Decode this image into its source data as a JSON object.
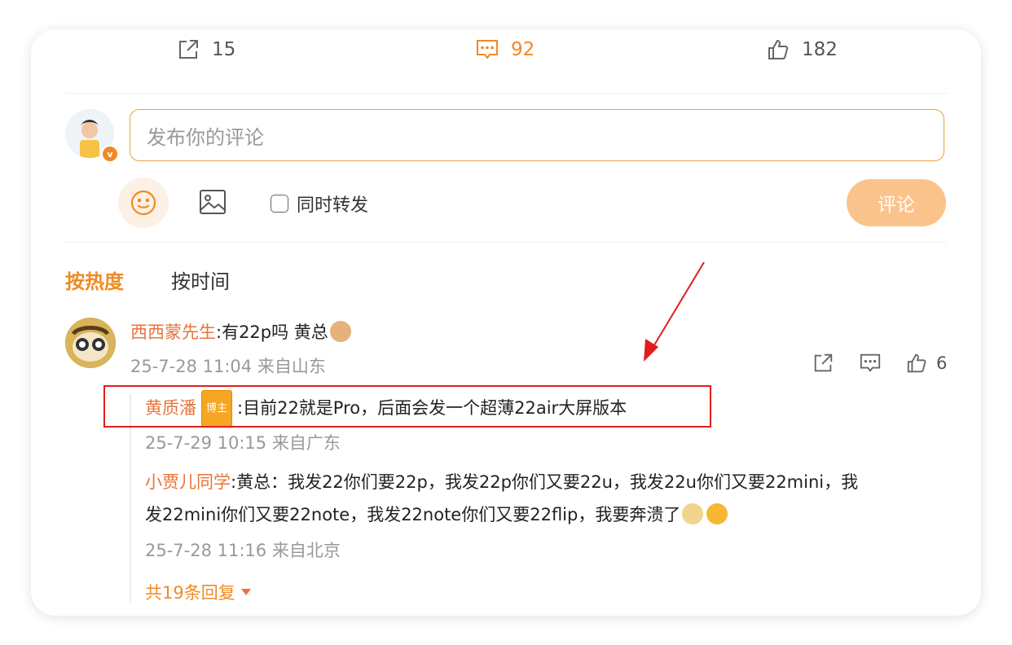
{
  "stats": {
    "share_count": "15",
    "comment_count": "92",
    "like_count": "182"
  },
  "compose": {
    "placeholder": "发布你的评论",
    "repost_label": "同时转发",
    "submit_label": "评论"
  },
  "tabs": [
    {
      "label": "按热度",
      "active": true
    },
    {
      "label": "按时间",
      "active": false
    }
  ],
  "comment": {
    "author": "西西蒙先生",
    "text": ":有22p吗 黄总",
    "time_location": "25-7-28 11:04 来自山东",
    "like_count": "6"
  },
  "replies": [
    {
      "author": "黄质潘",
      "badge": "博主",
      "text": ":目前22就是Pro，后面会发一个超薄22air大屏版本",
      "time_location": "25-7-29 10:15 来自广东"
    },
    {
      "author": "小贾儿同学",
      "text_line1": ":黄总：我发22你们要22p，我发22p你们又要22u，我发22u你们又要22mini，我",
      "text_line2": "发22mini你们又要22note，我发22note你们又要22flip，我要奔溃了",
      "time_location": "25-7-28 11:16 来自北京"
    }
  ],
  "more_replies_label": "共19条回复",
  "colors": {
    "accent": "#f08a24",
    "username": "#e8743b",
    "submit_bg": "#fbc38c",
    "annotation_red": "#e11d1d"
  }
}
